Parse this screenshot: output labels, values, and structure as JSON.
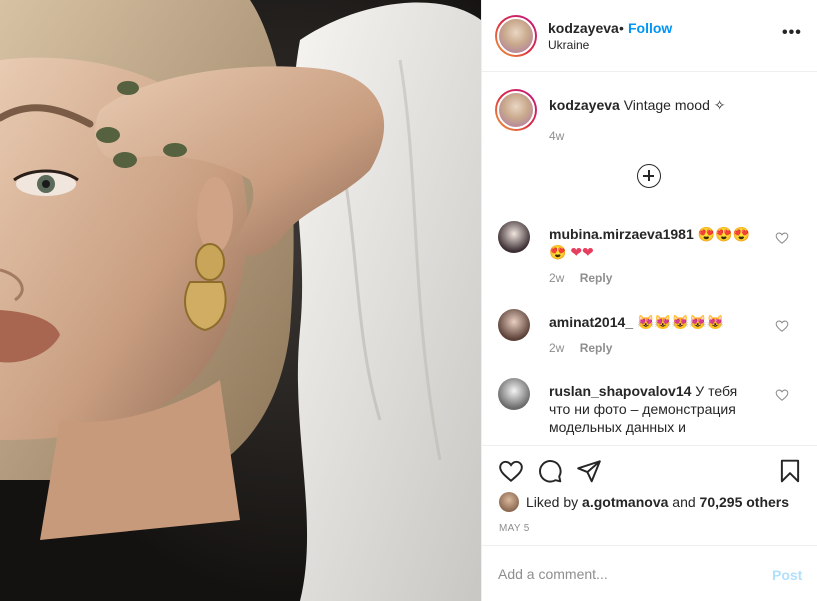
{
  "post": {
    "username": "kodzayeva",
    "follow_separator": "•",
    "follow_label": "Follow",
    "location": "Ukraine",
    "more_label": "•••",
    "caption": {
      "username": "kodzayeva",
      "text": "Vintage mood ✧",
      "time": "4w"
    }
  },
  "comments": [
    {
      "username": "mubina.mirzaeva1981",
      "text": "😍😍😍😍 ❤❤",
      "time": "2w",
      "reply": "Reply"
    },
    {
      "username": "aminat2014_",
      "text": "😻😻😻😻😻",
      "time": "2w",
      "reply": "Reply"
    },
    {
      "username": "ruslan_shapovalov14",
      "text": "У тебя что ни фото – демонстрация модельных данных и",
      "time": "",
      "reply": ""
    }
  ],
  "likes": {
    "prefix": "Liked by ",
    "user": "a.gotmanova",
    "middle": " and ",
    "others": "70,295 others"
  },
  "date": "MAY 5",
  "add_comment": {
    "placeholder": "Add a comment...",
    "post_label": "Post"
  },
  "colors": {
    "accent": "#0095f6",
    "post_disabled": "#b2dffc",
    "muted": "#8e8e8e",
    "text": "#262626",
    "border": "#efefef"
  },
  "icons": [
    "more-options-icon",
    "add-comments-icon",
    "heart-icon",
    "comment-icon",
    "share-icon",
    "bookmark-icon"
  ]
}
